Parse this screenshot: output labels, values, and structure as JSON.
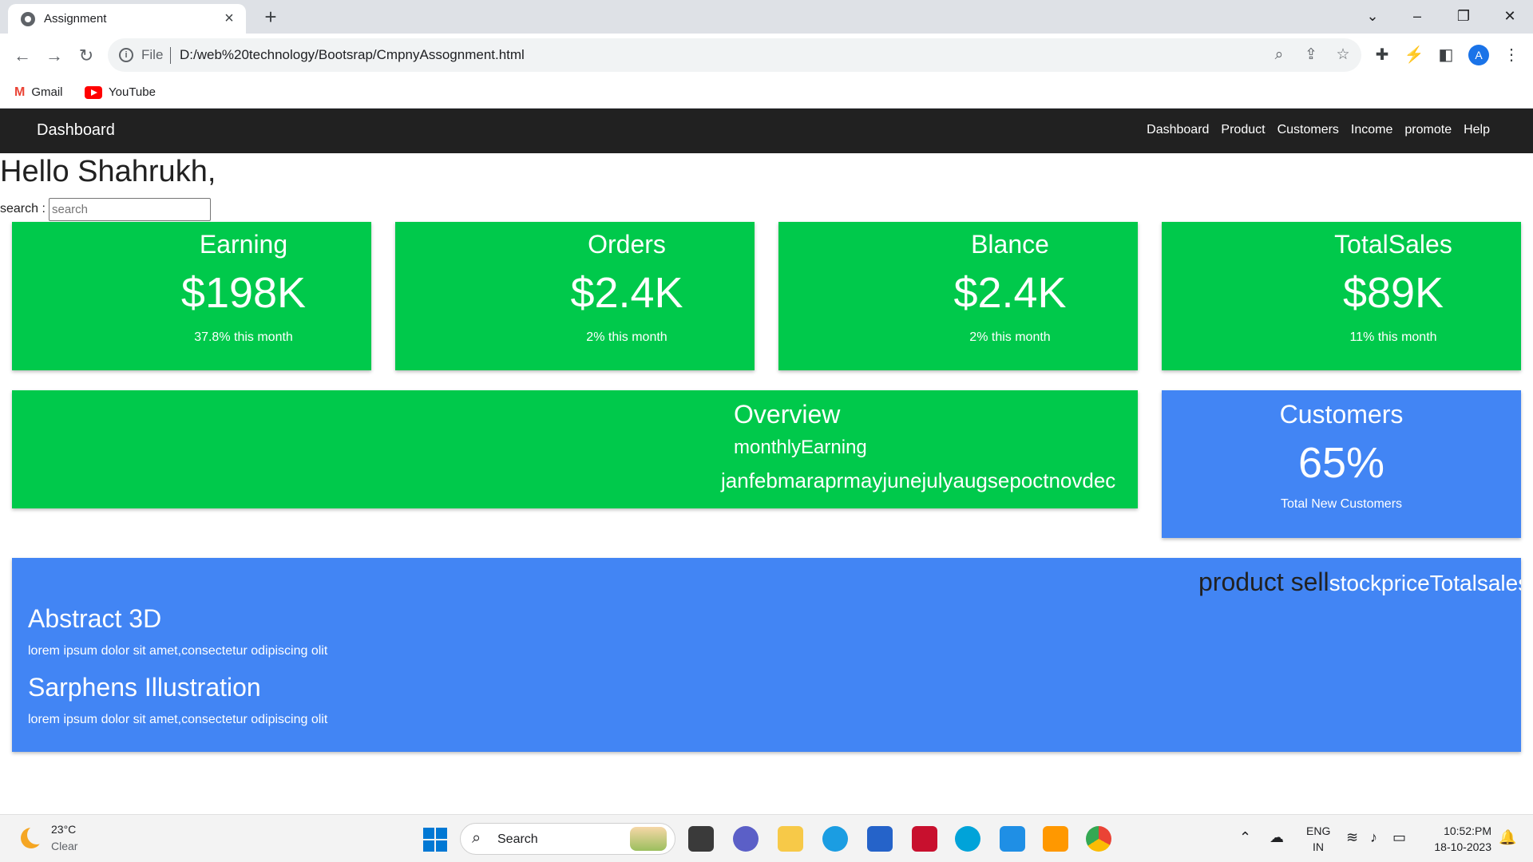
{
  "browser": {
    "tab_title": "Assignment",
    "url_scheme_label": "File",
    "url": "D:/web%20technology/Bootsrap/CmpnyAssognment.html",
    "bookmarks": [
      {
        "label": "Gmail",
        "icon": "gmail-icon"
      },
      {
        "label": "YouTube",
        "icon": "youtube-icon"
      }
    ],
    "profile_initial": "A"
  },
  "navbar": {
    "brand": "Dashboard",
    "links": [
      "Dashboard",
      "Product",
      "Customers",
      "Income",
      "promote",
      "Help"
    ]
  },
  "page": {
    "greeting": "Hello Shahrukh,",
    "search_label": "search :",
    "search_placeholder": "search"
  },
  "stats": [
    {
      "title": "Earning",
      "value": "$198K",
      "subtitle": "37.8% this month"
    },
    {
      "title": "Orders",
      "value": "$2.4K",
      "subtitle": "2% this month"
    },
    {
      "title": "Blance",
      "value": "$2.4K",
      "subtitle": "2% this month"
    },
    {
      "title": "TotalSales",
      "value": "$89K",
      "subtitle": "11% this month"
    }
  ],
  "overview": {
    "title": "Overview",
    "subtitle": "monthlyEarning",
    "months": "janfebmaraprmayjunejulyaugsepoctnovdec"
  },
  "customers": {
    "title": "Customers",
    "value": "65%",
    "subtitle": "Total New Customers"
  },
  "products": {
    "header_main": "product sell",
    "header_cols": "stockpriceTotalsales",
    "items": [
      {
        "name": "Abstract 3D",
        "description": "lorem ipsum dolor sit amet,consectetur odipiscing olit"
      },
      {
        "name": "Sarphens Illustration",
        "description": "lorem ipsum dolor sit amet,consectetur odipiscing olit"
      }
    ]
  },
  "taskbar": {
    "weather_temp": "23°C",
    "weather_condition": "Clear",
    "search_label": "Search",
    "language": "ENG",
    "region": "IN",
    "time": "10:52:PM",
    "date": "18-10-2023"
  },
  "colors": {
    "card_green": "#00c94b",
    "card_blue": "#4285f4",
    "navbar": "#212121"
  }
}
